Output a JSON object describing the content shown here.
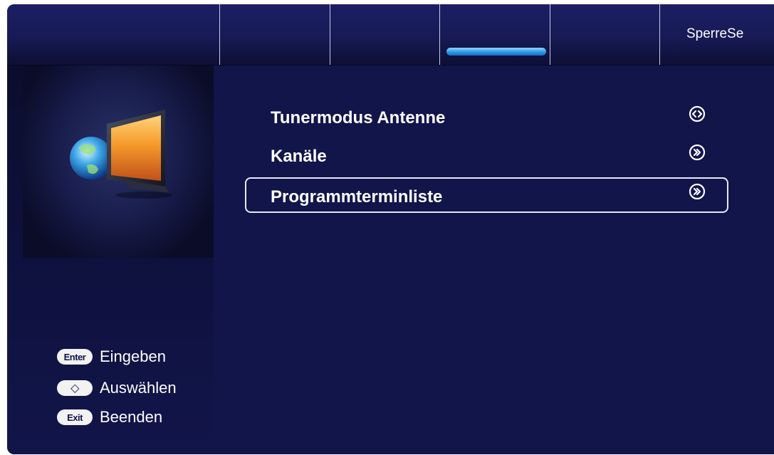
{
  "tabs": [
    {
      "label": ""
    },
    {
      "label": ""
    },
    {
      "label": ""
    },
    {
      "label": "",
      "selected": true
    },
    {
      "label": ""
    },
    {
      "label": "SperreSe"
    }
  ],
  "menu": {
    "items": [
      {
        "label": "Tunermodus Antenne",
        "arrow": "left-right-arrow-icon"
      },
      {
        "label": "Kanäle",
        "arrow": "double-right-arrow-icon"
      },
      {
        "label": "Programmterminliste",
        "arrow": "double-right-arrow-icon",
        "selected": true
      }
    ]
  },
  "legend": {
    "enter": {
      "key": "Enter",
      "text": "Eingeben"
    },
    "select": {
      "key": "◇",
      "text": "Auswählen"
    },
    "exit": {
      "key": "Exit",
      "text": "Beenden"
    }
  },
  "colors": {
    "background": "#12154a",
    "accent": "#2d9ae6",
    "text": "#ffffff"
  }
}
